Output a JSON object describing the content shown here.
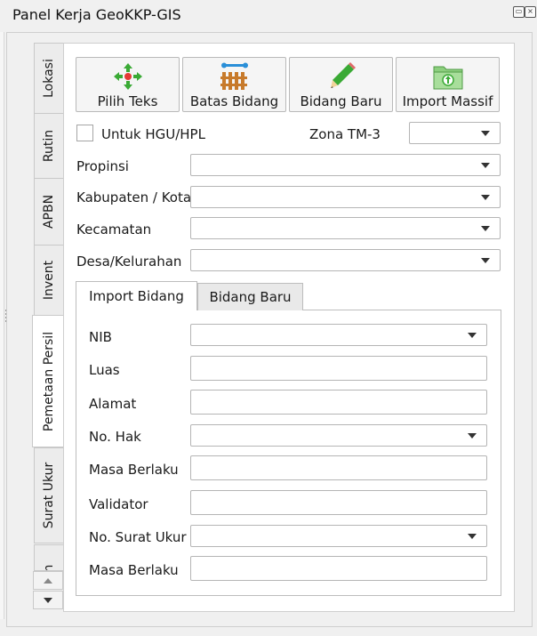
{
  "window": {
    "title": "Panel Kerja GeoKKP-GIS"
  },
  "side_tabs": [
    {
      "label": "Lokasi"
    },
    {
      "label": "Rutin"
    },
    {
      "label": "APBN"
    },
    {
      "label": "Invent"
    },
    {
      "label": "Pemetaan Persil"
    },
    {
      "label": "Surat Ukur"
    },
    {
      "label": "h"
    }
  ],
  "active_side_tab": "Pemetaan Persil",
  "toolbar": {
    "pilih_teks": "Pilih Teks",
    "batas_bidang": "Batas Bidang",
    "bidang_baru": "Bidang Baru",
    "import_massif": "Import Massif"
  },
  "hgu": {
    "checkbox_label": "Untuk HGU/HPL",
    "checked": false,
    "zona_label": "Zona TM-3",
    "zona_value": ""
  },
  "location": {
    "propinsi_label": "Propinsi",
    "propinsi_value": "",
    "kabupaten_label": "Kabupaten / Kota",
    "kabupaten_value": "",
    "kecamatan_label": "Kecamatan",
    "kecamatan_value": "",
    "desa_label": "Desa/Kelurahan",
    "desa_value": ""
  },
  "inner_tabs": {
    "import_bidang": "Import Bidang",
    "bidang_baru": "Bidang Baru",
    "active": "Import Bidang"
  },
  "form": {
    "nib_label": "NIB",
    "nib_value": "",
    "luas_label": "Luas",
    "luas_value": "",
    "alamat_label": "Alamat",
    "alamat_value": "",
    "no_hak_label": "No. Hak",
    "no_hak_value": "",
    "masa_berlaku_label": "Masa Berlaku",
    "masa_berlaku_value": "",
    "validator_label": "Validator",
    "validator_value": "",
    "no_surat_ukur_label": "No. Surat Ukur",
    "no_surat_ukur_value": "",
    "masa_berlaku_2_label": "Masa Berlaku",
    "masa_berlaku_2_value": ""
  },
  "colors": {
    "accent_green": "#3aaa35",
    "accent_orange": "#c77a2b",
    "panel_bg": "#f0f0f0"
  },
  "icons": {
    "pilih_teks": "select-text-icon",
    "batas_bidang": "fence-icon",
    "bidang_baru": "pencil-icon",
    "import_massif": "folder-import-icon"
  }
}
